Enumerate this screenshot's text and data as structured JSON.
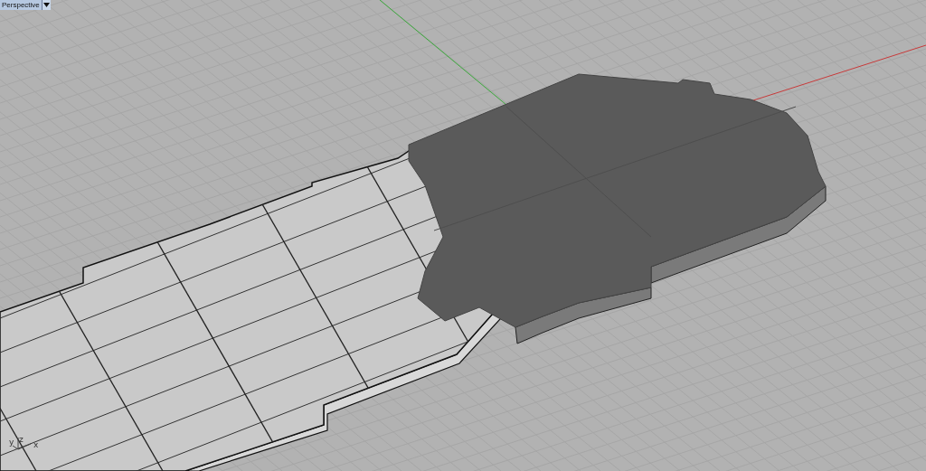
{
  "viewport": {
    "label": "Perspective",
    "axis_labels": [
      "y",
      "z",
      "x"
    ]
  }
}
